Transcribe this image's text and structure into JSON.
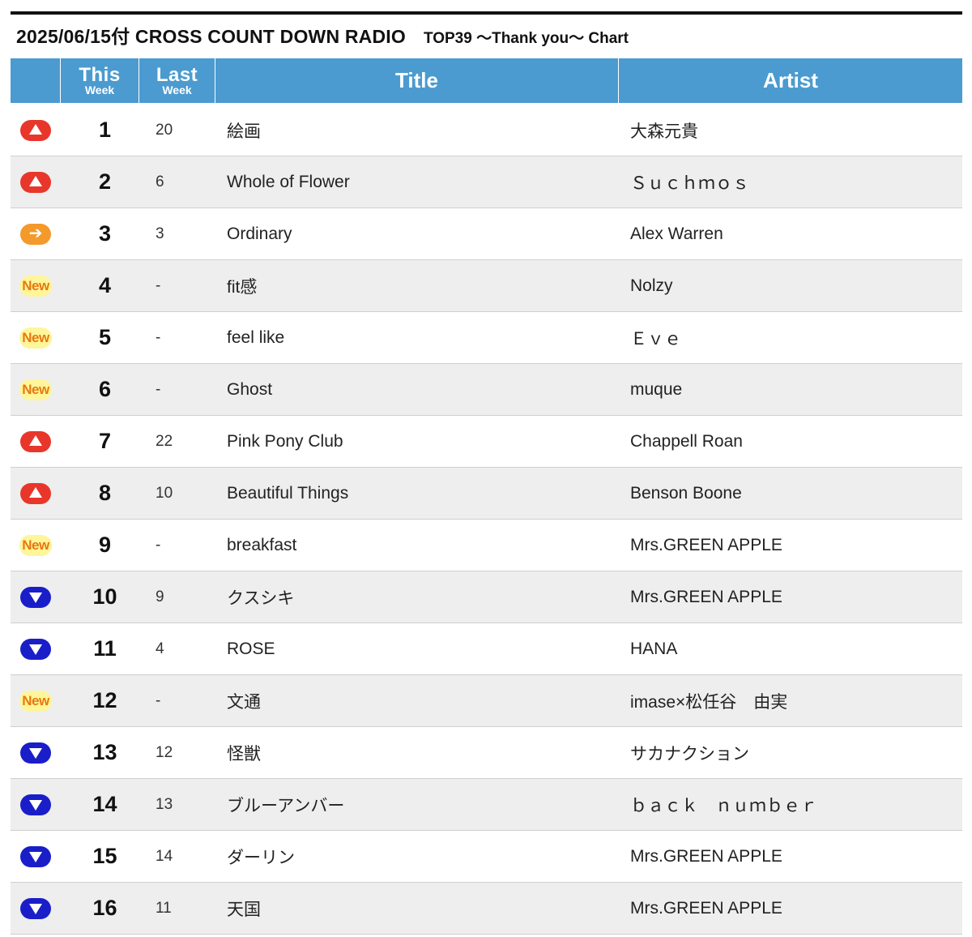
{
  "header": {
    "title": "2025/06/15付 CROSS COUNT DOWN RADIO",
    "subtitle": "TOP39 〜Thank you〜 Chart"
  },
  "columns": {
    "this_top": "This",
    "this_bottom": "Week",
    "last_top": "Last",
    "last_bottom": "Week",
    "title": "Title",
    "artist": "Artist"
  },
  "badge_labels": {
    "new": "New"
  },
  "colors": {
    "header_bg": "#4b9bd0",
    "up": "#e8362b",
    "down": "#1a1ec9",
    "stay": "#f39a2b",
    "new_bg": "#fff59a",
    "new_text": "#e8780e",
    "row_alt": "#eeeeee"
  },
  "rows": [
    {
      "status": "up",
      "this_week": "1",
      "last_week": "20",
      "title": "絵画",
      "artist": "大森元貴"
    },
    {
      "status": "up",
      "this_week": "2",
      "last_week": "6",
      "title": "Whole of Flower",
      "artist": "Ｓｕｃｈｍｏｓ"
    },
    {
      "status": "stay",
      "this_week": "3",
      "last_week": "3",
      "title": "Ordinary",
      "artist": "Alex Warren"
    },
    {
      "status": "new",
      "this_week": "4",
      "last_week": "-",
      "title": "fit感",
      "artist": "Nolzy"
    },
    {
      "status": "new",
      "this_week": "5",
      "last_week": "-",
      "title": "feel like",
      "artist": "Ｅｖｅ"
    },
    {
      "status": "new",
      "this_week": "6",
      "last_week": "-",
      "title": "Ghost",
      "artist": "muque"
    },
    {
      "status": "up",
      "this_week": "7",
      "last_week": "22",
      "title": "Pink Pony Club",
      "artist": "Chappell Roan"
    },
    {
      "status": "up",
      "this_week": "8",
      "last_week": "10",
      "title": "Beautiful Things",
      "artist": "Benson Boone"
    },
    {
      "status": "new",
      "this_week": "9",
      "last_week": "-",
      "title": "breakfast",
      "artist": "Mrs.GREEN APPLE"
    },
    {
      "status": "down",
      "this_week": "10",
      "last_week": "9",
      "title": "クスシキ",
      "artist": "Mrs.GREEN APPLE"
    },
    {
      "status": "down",
      "this_week": "11",
      "last_week": "4",
      "title": "ROSE",
      "artist": "HANA"
    },
    {
      "status": "new",
      "this_week": "12",
      "last_week": "-",
      "title": "文通",
      "artist": "imase×松任谷　由実"
    },
    {
      "status": "down",
      "this_week": "13",
      "last_week": "12",
      "title": "怪獣",
      "artist": "サカナクション"
    },
    {
      "status": "down",
      "this_week": "14",
      "last_week": "13",
      "title": "ブルーアンバー",
      "artist": "ｂａｃｋ　ｎｕｍｂｅｒ"
    },
    {
      "status": "down",
      "this_week": "15",
      "last_week": "14",
      "title": "ダーリン",
      "artist": "Mrs.GREEN APPLE"
    },
    {
      "status": "down",
      "this_week": "16",
      "last_week": "11",
      "title": "天国",
      "artist": "Mrs.GREEN APPLE"
    }
  ]
}
